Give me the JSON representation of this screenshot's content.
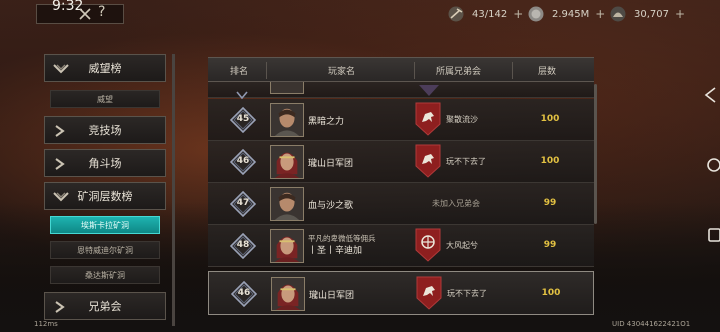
{
  "status": {
    "time": "9:32"
  },
  "topbar": {
    "help_label": "?"
  },
  "resources": [
    {
      "icon": "pickaxe-icon",
      "value": "43/142",
      "plus": "+"
    },
    {
      "icon": "silver-coin-icon",
      "value": "2.945M",
      "plus": "+"
    },
    {
      "icon": "helmet-icon",
      "value": "30,707",
      "plus": "+"
    }
  ],
  "sidebar": {
    "sections": [
      {
        "label": "威望榜",
        "expanded": true
      },
      {
        "label": "竞技场",
        "expanded": false
      },
      {
        "label": "角斗场",
        "expanded": false
      },
      {
        "label": "矿洞层数榜",
        "expanded": true
      },
      {
        "label": "兄弟会",
        "expanded": false
      }
    ],
    "prestige_subs": [
      "威望"
    ],
    "mine_subs": [
      "埃斯卡拉矿洞",
      "恩特威迪尔矿洞",
      "桑达斯矿洞"
    ],
    "active_sub": "埃斯卡拉矿洞"
  },
  "table": {
    "headers": {
      "rank": "排名",
      "player": "玩家名",
      "guild": "所属兄弟会",
      "floors": "层数"
    },
    "rows": [
      {
        "rank": "45",
        "player": "黑暗之力",
        "guild": "聚散流沙",
        "floors": "100",
        "avatar": "male"
      },
      {
        "rank": "46",
        "player": "瓏山日军团",
        "guild": "玩不下去了",
        "floors": "100",
        "avatar": "female"
      },
      {
        "rank": "47",
        "player": "血与沙之歌",
        "guild": "未加入兄弟会",
        "floors": "99",
        "avatar": "male"
      },
      {
        "rank": "48",
        "player_line1": "平凡的卑微低等佣兵",
        "player_line2": "丨圣丨辛迪加",
        "guild": "大风起兮",
        "floors": "99",
        "avatar": "female"
      }
    ],
    "my_row": {
      "rank": "46",
      "player": "瓏山日军团",
      "guild": "玩不下去了",
      "floors": "100",
      "avatar": "female"
    }
  },
  "footer": {
    "latency": "112ms",
    "uid": "UID 430441622421O1"
  },
  "colors": {
    "accent_teal": "#1fb3b0",
    "score_gold": "#e2c142",
    "guild_emblem_red": "#8e1f1f"
  }
}
